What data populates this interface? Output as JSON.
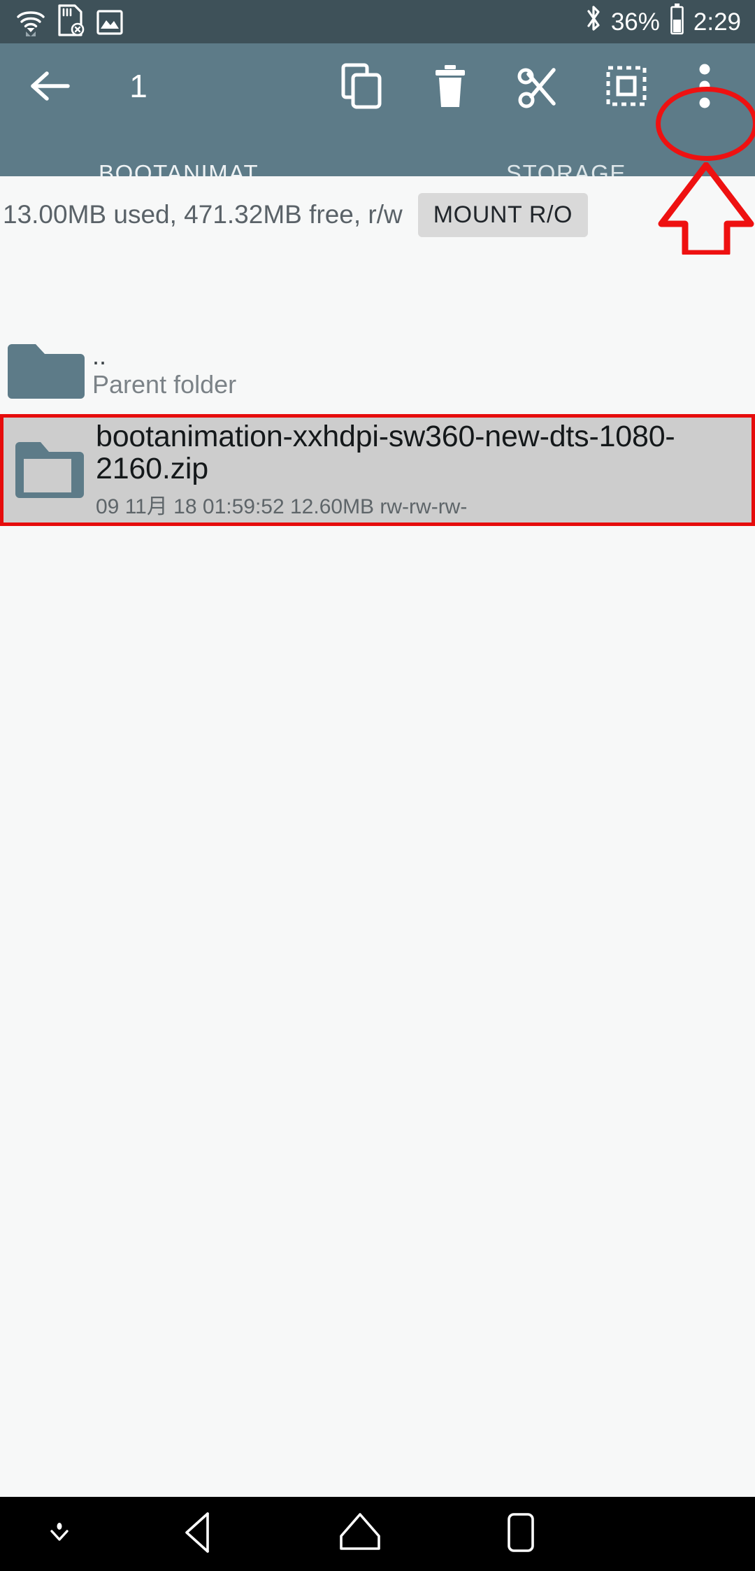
{
  "status_bar": {
    "icons": [
      "wifi-icon",
      "sdcard-error-icon",
      "screenshot-image-icon",
      "bluetooth-icon"
    ],
    "battery_percent": "36%",
    "clock": "2:29"
  },
  "toolbar": {
    "back_label": "back-arrow",
    "selection_count": "1",
    "actions": [
      {
        "name": "copy-button",
        "label": "Copy"
      },
      {
        "name": "delete-button",
        "label": "Delete"
      },
      {
        "name": "cut-button",
        "label": "Cut"
      },
      {
        "name": "select-all-button",
        "label": "Select all"
      },
      {
        "name": "overflow-menu-button",
        "label": "More options"
      }
    ]
  },
  "tabs": [
    {
      "label": "BOOTANIMAT...",
      "active": true
    },
    {
      "label": "STORAGE",
      "active": false
    }
  ],
  "info_bar": {
    "storage_text": "13.00MB used, 471.32MB free, r/w",
    "mount_button": "MOUNT R/O"
  },
  "file_list": [
    {
      "name": "..",
      "subtitle": "Parent folder",
      "icon": "folder-filled-icon",
      "selected": false
    },
    {
      "name": "bootanimation-xxhdpi-sw360-new-dts-1080-2160.zip",
      "meta": "09 11月 18 01:59:52  12.60MB  rw-rw-rw-",
      "icon": "folder-outline-icon",
      "selected": true
    }
  ],
  "annotations": {
    "highlight_color": "#ee1111",
    "ellipse_target": "overflow-menu-button",
    "arrow_points_to": "overflow-menu-button"
  },
  "nav_bar": [
    {
      "name": "nav-hide-button",
      "label": "Hide navigation"
    },
    {
      "name": "nav-back-button",
      "label": "Back"
    },
    {
      "name": "nav-home-button",
      "label": "Home"
    },
    {
      "name": "nav-recents-button",
      "label": "Recents"
    }
  ],
  "colors": {
    "status_bar_bg": "#3e5159",
    "app_bar_bg": "#5d7b88",
    "page_bg": "#f7f8f8",
    "selected_row_bg": "#cdcdcd",
    "folder_icon": "#5d7b88",
    "accent_red": "#ee1111"
  }
}
